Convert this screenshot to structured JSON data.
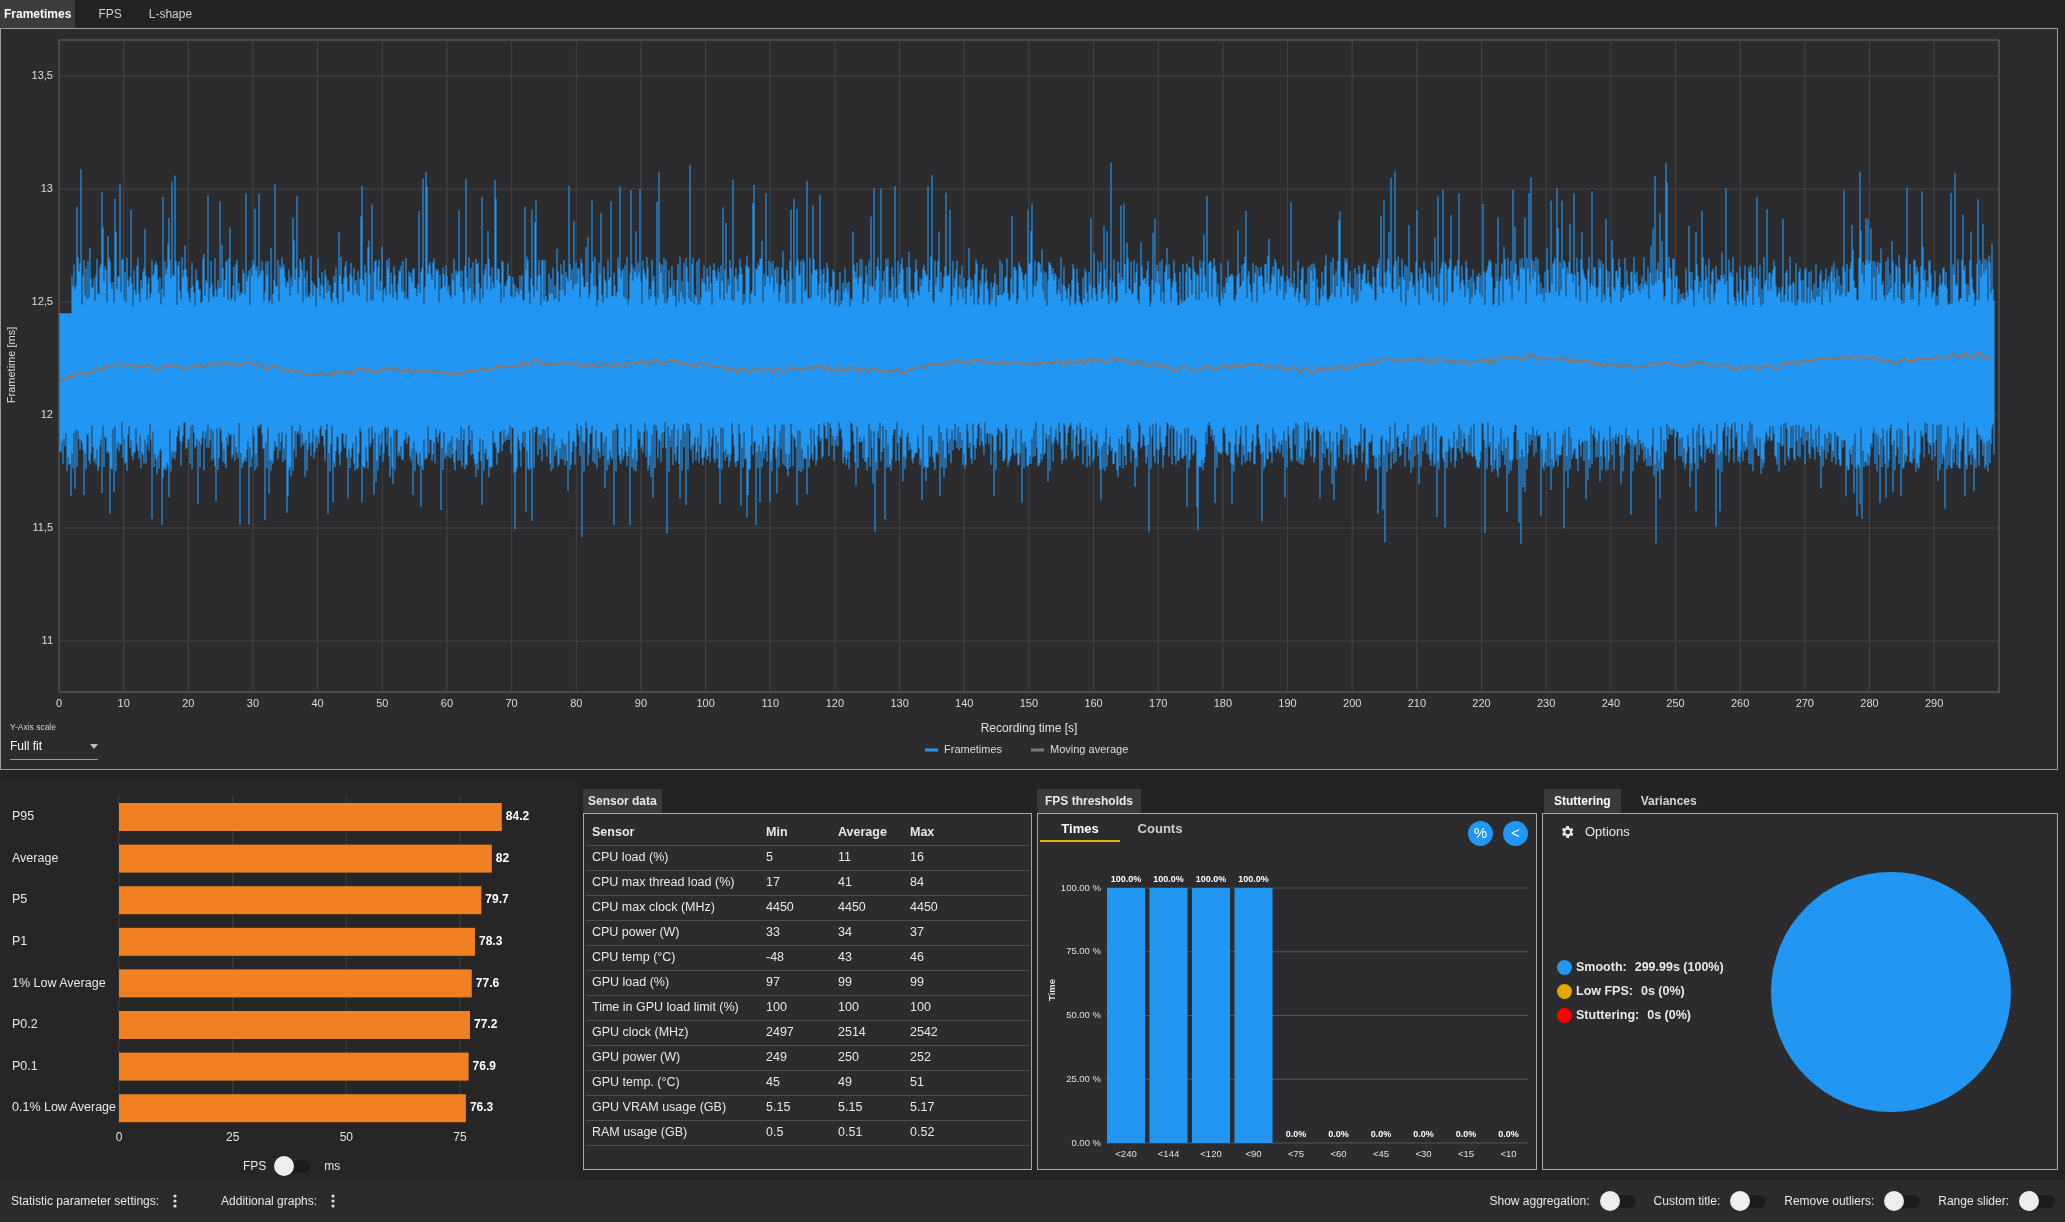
{
  "tabs": [
    {
      "label": "Frametimes",
      "selected": true
    },
    {
      "label": "FPS",
      "selected": false
    },
    {
      "label": "L-shape",
      "selected": false
    }
  ],
  "frametime_chart": {
    "ylabel": "Frametime [ms]",
    "xlabel": "Recording time [s]",
    "yticks": [
      "13,5",
      "13",
      "12,5",
      "12",
      "11,5",
      "11"
    ],
    "xticks": [
      "0",
      "10",
      "20",
      "30",
      "40",
      "50",
      "60",
      "70",
      "80",
      "90",
      "100",
      "110",
      "120",
      "130",
      "140",
      "150",
      "160",
      "170",
      "180",
      "190",
      "200",
      "210",
      "220",
      "230",
      "240",
      "250",
      "260",
      "270",
      "280",
      "290"
    ],
    "legend": [
      {
        "name": "Frametimes",
        "color": "#2196f3"
      },
      {
        "name": "Moving average",
        "color": "#8c7468"
      }
    ]
  },
  "y_axis_scale": {
    "label": "Y-Axis scale",
    "value": "Full fit"
  },
  "statistics": {
    "chart_data": {
      "type": "bar",
      "orientation": "horizontal",
      "categories": [
        "P95",
        "Average",
        "P5",
        "P1",
        "1% Low Average",
        "P0.2",
        "P0.1",
        "0.1% Low Average"
      ],
      "series": [
        {
          "color": "#f08022",
          "values": [
            84.2,
            82,
            79.7,
            78.3,
            77.6,
            77.2,
            76.9,
            76.3
          ]
        }
      ],
      "xticks": [
        0,
        25,
        50,
        75
      ],
      "xlim": [
        0,
        84.2
      ],
      "grid": true,
      "value_labels": [
        "84.2",
        "82",
        "79.7",
        "78.3",
        "77.6",
        "77.2",
        "76.9",
        "76.3"
      ]
    },
    "unit_toggle": {
      "left_label": "FPS",
      "right_label": "ms",
      "on": false
    }
  },
  "sensor_data": {
    "tab": "Sensor data",
    "columns": [
      "Sensor",
      "Min",
      "Average",
      "Max"
    ],
    "rows": [
      [
        "CPU load (%)",
        "5",
        "11",
        "16"
      ],
      [
        "CPU max thread load (%)",
        "17",
        "41",
        "84"
      ],
      [
        "CPU max clock (MHz)",
        "4450",
        "4450",
        "4450"
      ],
      [
        "CPU power (W)",
        "33",
        "34",
        "37"
      ],
      [
        "CPU temp (°C)",
        "-48",
        "43",
        "46"
      ],
      [
        "GPU load (%)",
        "97",
        "99",
        "99"
      ],
      [
        "Time in GPU load limit (%)",
        "100",
        "100",
        "100"
      ],
      [
        "GPU clock (MHz)",
        "2497",
        "2514",
        "2542"
      ],
      [
        "GPU power (W)",
        "249",
        "250",
        "252"
      ],
      [
        "GPU temp. (°C)",
        "45",
        "49",
        "51"
      ],
      [
        "GPU VRAM usage (GB)",
        "5.15",
        "5.15",
        "5.17"
      ],
      [
        "RAM usage (GB)",
        "0.5",
        "0.51",
        "0.52"
      ]
    ]
  },
  "fps_thresholds": {
    "tab": "FPS thresholds",
    "view_tabs": [
      {
        "label": "Times",
        "selected": true
      },
      {
        "label": "Counts",
        "selected": false
      }
    ],
    "buttons": [
      "%",
      "<"
    ],
    "chart_data": {
      "type": "bar",
      "ylabel": "Time",
      "categories": [
        "<240",
        "<144",
        "<120",
        "<90",
        "<75",
        "<60",
        "<45",
        "<30",
        "<15",
        "<10"
      ],
      "series": [
        {
          "color": "#2196f3",
          "values": [
            100,
            100,
            100,
            100,
            0,
            0,
            0,
            0,
            0,
            0
          ]
        }
      ],
      "ylim": [
        0,
        100
      ],
      "grid": true,
      "yticks": [
        {
          "value": 0,
          "label": "0.00 %"
        },
        {
          "value": 25,
          "label": "25.00 %"
        },
        {
          "value": 50,
          "label": "50.00 %"
        },
        {
          "value": 75,
          "label": "75.00 %"
        },
        {
          "value": 100,
          "label": "100.00 %"
        }
      ],
      "value_labels": [
        "100.0%",
        "100.0%",
        "100.0%",
        "100.0%",
        "0.0%",
        "0.0%",
        "0.0%",
        "0.0%",
        "0.0%",
        "0.0%"
      ]
    }
  },
  "stuttering": {
    "tabs": [
      {
        "label": "Stuttering",
        "selected": true
      },
      {
        "label": "Variances",
        "selected": false
      }
    ],
    "options_label": "Options",
    "chart_data": {
      "type": "pie",
      "series": [
        {
          "values": [
            100,
            0,
            0
          ]
        }
      ]
    },
    "legend": [
      {
        "label": "Smooth:",
        "value": "299.99s (100%)",
        "color": "#2196f3"
      },
      {
        "label": "Low FPS:",
        "value": "0s (0%)",
        "color": "#e0a800"
      },
      {
        "label": "Stuttering:",
        "value": "0s (0%)",
        "color": "#ff0000"
      }
    ]
  },
  "footer": {
    "menus": [
      "Statistic parameter settings:",
      "Additional graphs:"
    ],
    "toggles": [
      {
        "label": "Show aggregation:",
        "on": false
      },
      {
        "label": "Custom title:",
        "on": false
      },
      {
        "label": "Remove outliers:",
        "on": false
      },
      {
        "label": "Range slider:",
        "on": false
      }
    ]
  }
}
